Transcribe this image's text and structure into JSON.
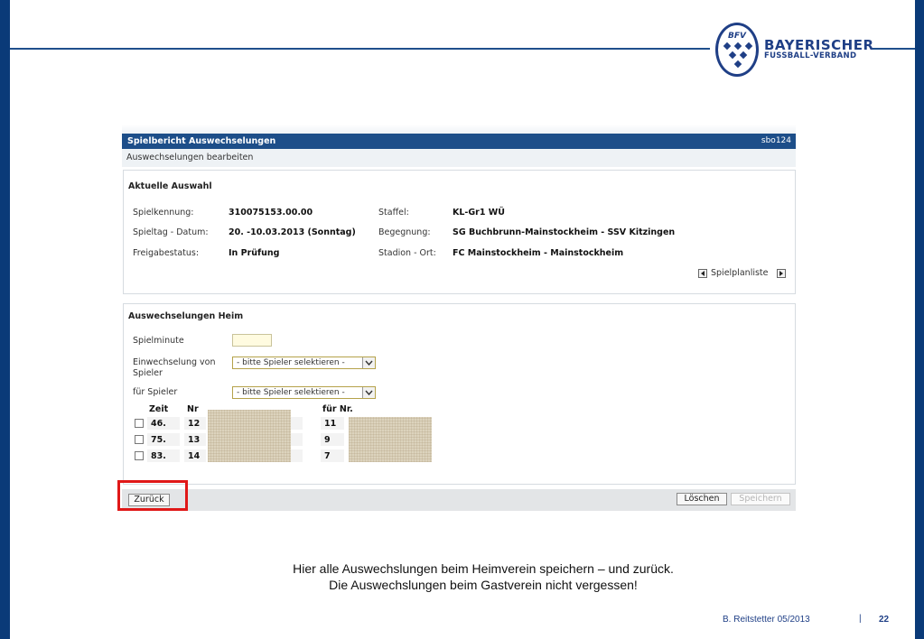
{
  "header": {
    "logo_mark": "BFV",
    "logo_line1": "BAYERISCHER",
    "logo_line2": "FUSSBALL-VERBAND",
    "brand_color": "#1f3f86",
    "frame_color": "#0a3a78"
  },
  "app": {
    "title": "Spielbericht Auswechselungen",
    "code": "sbo124",
    "subtitle": "Auswechselungen bearbeiten",
    "current_selection": {
      "title": "Aktuelle Auswahl",
      "fields": [
        {
          "label": "Spielkennung:",
          "value": "310075153.00.00"
        },
        {
          "label": "Spieltag - Datum:",
          "value": "20. -10.03.2013 (Sonntag)"
        },
        {
          "label": "Freigabestatus:",
          "value": "In Prüfung"
        },
        {
          "label": "Staffel:",
          "value": "KL-Gr1 WÜ"
        },
        {
          "label": "Begegnung:",
          "value": "SG Buchbrunn-Mainstockheim - SSV Kitzingen"
        },
        {
          "label": "Stadion - Ort:",
          "value": "FC Mainstockheim - Mainstockheim"
        }
      ],
      "nav_label": "Spielplanliste"
    },
    "home_subs": {
      "title": "Auswechselungen Heim",
      "minute_label": "Spielminute",
      "minute_value": "",
      "sub_from_label_1": "Einwechselung von",
      "sub_from_label_2": "Spieler",
      "for_player_label": "für Spieler",
      "select_placeholder": "- bitte Spieler selektieren -",
      "table_headers": {
        "time": "Zeit",
        "nr": "Nr",
        "for_nr": "für Nr."
      },
      "rows": [
        {
          "time": "46.",
          "nr": "12",
          "for_nr": "11"
        },
        {
          "time": "75.",
          "nr": "13",
          "for_nr": "9"
        },
        {
          "time": "83.",
          "nr": "14",
          "for_nr": "7"
        }
      ]
    },
    "footer": {
      "back_label": "Zurück",
      "delete_label": "Löschen",
      "save_label": "Speichern"
    }
  },
  "caption": {
    "line1": "Hier alle Auswechslungen beim Heimverein speichern – und zurück.",
    "line2": "Die Auswechslungen beim Gastverein nicht vergessen!"
  },
  "slide_footer": {
    "author": "B. Reitstetter  05/2013",
    "separator": "|",
    "page": "22"
  }
}
